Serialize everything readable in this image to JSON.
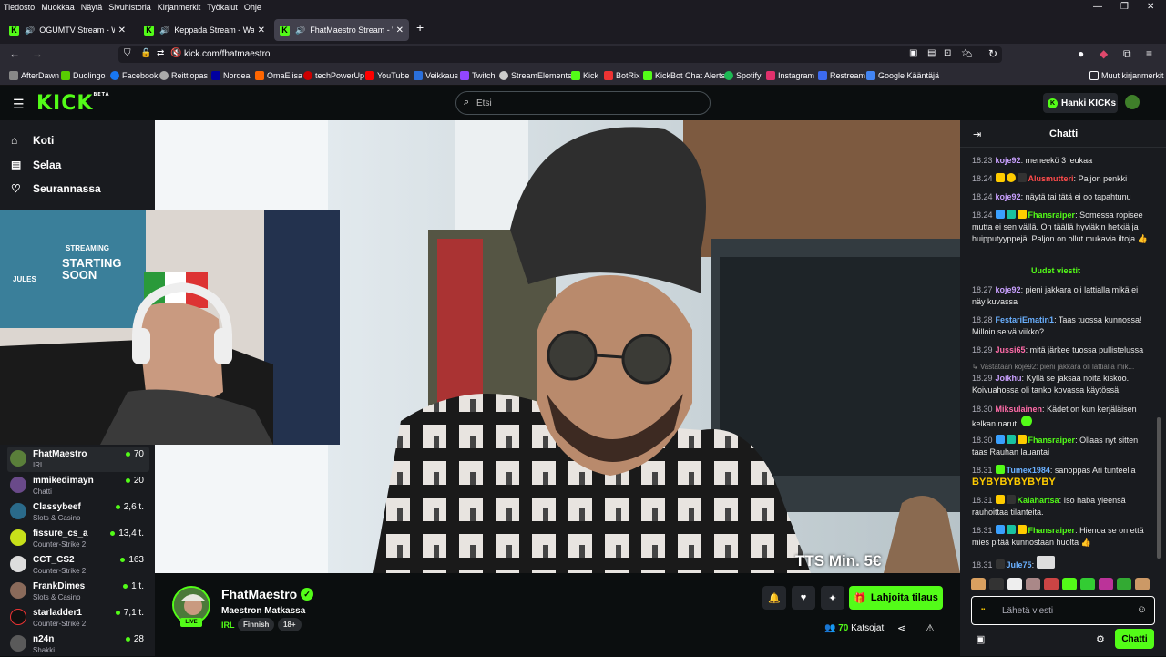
{
  "menubar": [
    "Tiedosto",
    "Muokkaa",
    "Näytä",
    "Sivuhistoria",
    "Kirjanmerkit",
    "Työkalut",
    "Ohje"
  ],
  "tabs": [
    {
      "title": "OGUMTV Stream - Watch L"
    },
    {
      "title": "Keppada Stream - Watch Li"
    },
    {
      "title": "FhatMaestro Stream - Watc"
    }
  ],
  "url": "kick.com/fhatmaestro",
  "bookmarks": [
    "AfterDawn",
    "Duolingo",
    "Facebook",
    "Reittiopas",
    "Nordea",
    "OmaElisa",
    "techPowerUp",
    "YouTube",
    "Veikkaus",
    "Twitch",
    "StreamElements",
    "Kick",
    "BotRix",
    "KickBot Chat Alerts",
    "Spotify",
    "Instagram",
    "Restream",
    "Google Kääntäjä"
  ],
  "bookmarks_other": "Muut kirjanmerkit",
  "header": {
    "logo": "KICK",
    "logo_beta": "BETA",
    "search_placeholder": "Etsi",
    "kicks_label": "Hanki KICKs"
  },
  "nav": [
    {
      "label": "Koti"
    },
    {
      "label": "Selaa"
    },
    {
      "label": "Seurannassa"
    }
  ],
  "channels": [
    {
      "name": "FhatMaestro",
      "category": "IRL",
      "viewers": "70"
    },
    {
      "name": "mmikedimayn",
      "category": "Chatti",
      "viewers": "20"
    },
    {
      "name": "Classybeef",
      "category": "Slots & Casino",
      "viewers": "2,6 t."
    },
    {
      "name": "fissure_cs_a",
      "category": "Counter-Strike 2",
      "viewers": "13,4 t."
    },
    {
      "name": "CCT_CS2",
      "category": "Counter-Strike 2",
      "viewers": "163"
    },
    {
      "name": "FrankDimes",
      "category": "Slots & Casino",
      "viewers": "1 t."
    },
    {
      "name": "starladder1",
      "category": "Counter-Strike 2",
      "viewers": "7,1 t."
    },
    {
      "name": "n24n",
      "category": "Shakki",
      "viewers": "28"
    }
  ],
  "webcam": {
    "sign_top": "STREAMING",
    "sign_main": "STARTING SOON",
    "sign_small": "JULES"
  },
  "video": {
    "tts": "TTS Min. 5€"
  },
  "stream": {
    "name": "FhatMaestro",
    "title": "Maestron Matkassa",
    "category": "IRL",
    "tags": [
      "Finnish",
      "18+"
    ],
    "live": "LIVE",
    "subscribe": "Lahjoita tilaus",
    "viewer_count": "70",
    "viewer_label": "Katsojat"
  },
  "chat": {
    "title": "Chatti",
    "new_messages": "Uudet viestit",
    "placeholder": "Lähetä viesti",
    "send": "Chatti",
    "messages": [
      {
        "time": "18.23",
        "user": "koje92",
        "color": "#c9a0ff",
        "text": "meneekö 3 leukaa"
      },
      {
        "time": "18.24",
        "user": "Alusmutteri",
        "color": "#ff4b4b",
        "text": "Paljon penkki"
      },
      {
        "time": "18.24",
        "user": "koje92",
        "color": "#c9a0ff",
        "text": "näytä tai tätä ei oo tapahtunu"
      },
      {
        "time": "18.24",
        "user": "Fhansraiper",
        "color": "#53fc18",
        "text": "Somessa ropisee mutta ei sen välIä. On täällä hyviäkin hetkiä ja huipputyyppejä. Paljon on ollut mukavia iltoja"
      },
      {
        "time": "18.27",
        "user": "koje92",
        "color": "#c9a0ff",
        "text": "pieni jakkara oli lattialla mikä ei näy kuvassa"
      },
      {
        "time": "18.28",
        "user": "FestariEmatin1",
        "color": "#6ab0ff",
        "text": "Taas tuossa kunnossa! Milloin selvä viikko?"
      },
      {
        "time": "18.29",
        "user": "Jussi65",
        "color": "#ff6ba8",
        "text": "mitä järkee tuossa pullistelussa"
      },
      {
        "time": "18.29",
        "user": "Joikhu",
        "color": "#c9a0ff",
        "text": "Kyllä se jaksaa noita kiskoo. Koivuahossa oli tanko kovassa käytössä"
      },
      {
        "time": "18.30",
        "user": "Miksulainen",
        "color": "#ff6ba8",
        "text": "Kädet on kun kerjäläisen kelkan narut."
      },
      {
        "time": "18.30",
        "user": "Fhansraiper",
        "color": "#53fc18",
        "text": "Ollaas nyt sitten taas  Rauhan lauantai"
      },
      {
        "time": "18.31",
        "user": "Tumex1984",
        "color": "#6ab0ff",
        "text": "sanoppas Ari tunteella"
      },
      {
        "time": "18.31",
        "user": "Kalahartsa",
        "color": "#53fc18",
        "text": "Iso haba yleensä rauhoittaa tilanteita."
      },
      {
        "time": "18.31",
        "user": "Fhansraiper",
        "color": "#53fc18",
        "text": "Hienoa se on että mies pitää kunnostaan huolta"
      },
      {
        "time": "18.31",
        "user": "Jule75",
        "color": "#6ab0ff",
        "text": ""
      }
    ],
    "reply": "Vastataan koje92: pieni jakkara oli lattialla mik...",
    "emote_text": "BYBYBYBYBYBY"
  }
}
